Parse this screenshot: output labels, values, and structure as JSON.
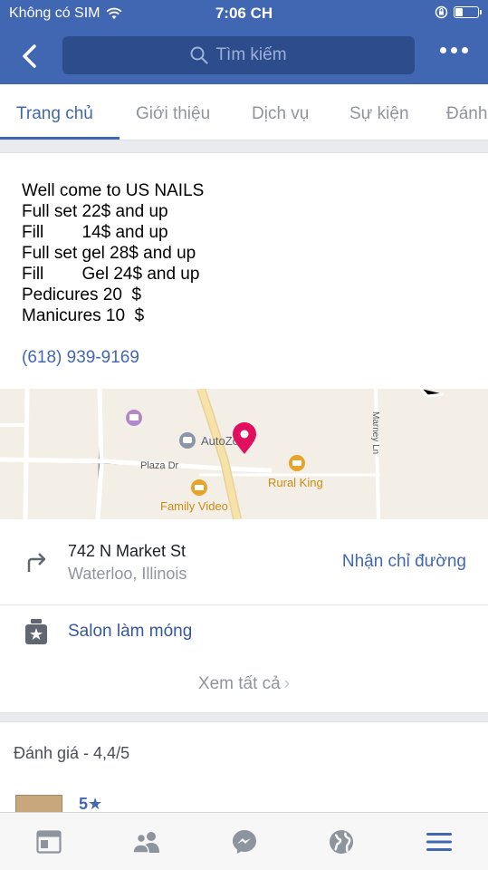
{
  "status_bar": {
    "carrier": "Không có SIM",
    "time": "7:06 CH",
    "battery_level": 0.35
  },
  "nav": {
    "search_placeholder": "Tìm kiếm"
  },
  "tabs": [
    {
      "label": "Trang chủ",
      "active": true
    },
    {
      "label": "Giới thiệu",
      "active": false
    },
    {
      "label": "Dịch vụ",
      "active": false
    },
    {
      "label": "Sự kiện",
      "active": false
    },
    {
      "label": "Đánh",
      "active": false
    }
  ],
  "about": {
    "lines": [
      "Well come to US NAILS",
      "Full set 22$ and up",
      "Fill        14$ and up",
      "Full set gel 28$ and up",
      "Fill        Gel 24$ and up",
      "Pedicures 20  $",
      "Manicures 10  $"
    ],
    "phone": "(618) 939-9169"
  },
  "map": {
    "labels": {
      "autozone": "AutoZone",
      "plaza_dr": "Plaza Dr",
      "rural_king": "Rural King",
      "family_video": "Family Video",
      "marney_ln": "Marney Ln"
    },
    "colors": {
      "pin": "#e0105f",
      "poi": "#e6a52a",
      "road_major": "#f7d98b"
    }
  },
  "address": {
    "line1": "742 N Market St",
    "line2": "Waterloo, Illinois",
    "directions": "Nhận chỉ đường"
  },
  "category": {
    "label": "Salon làm móng"
  },
  "see_all": {
    "label": "Xem tất cả"
  },
  "reviews": {
    "title": "Đánh giá - 4,4/5",
    "first_rating": "5★"
  },
  "bottom_nav": [
    {
      "icon": "news-feed-icon",
      "active": false
    },
    {
      "icon": "friends-icon",
      "active": false
    },
    {
      "icon": "messenger-icon",
      "active": false
    },
    {
      "icon": "globe-icon",
      "active": false
    },
    {
      "icon": "menu-icon",
      "active": true
    }
  ],
  "colors": {
    "brand": "#4267b2",
    "link": "#365899",
    "muted": "#90949c"
  }
}
